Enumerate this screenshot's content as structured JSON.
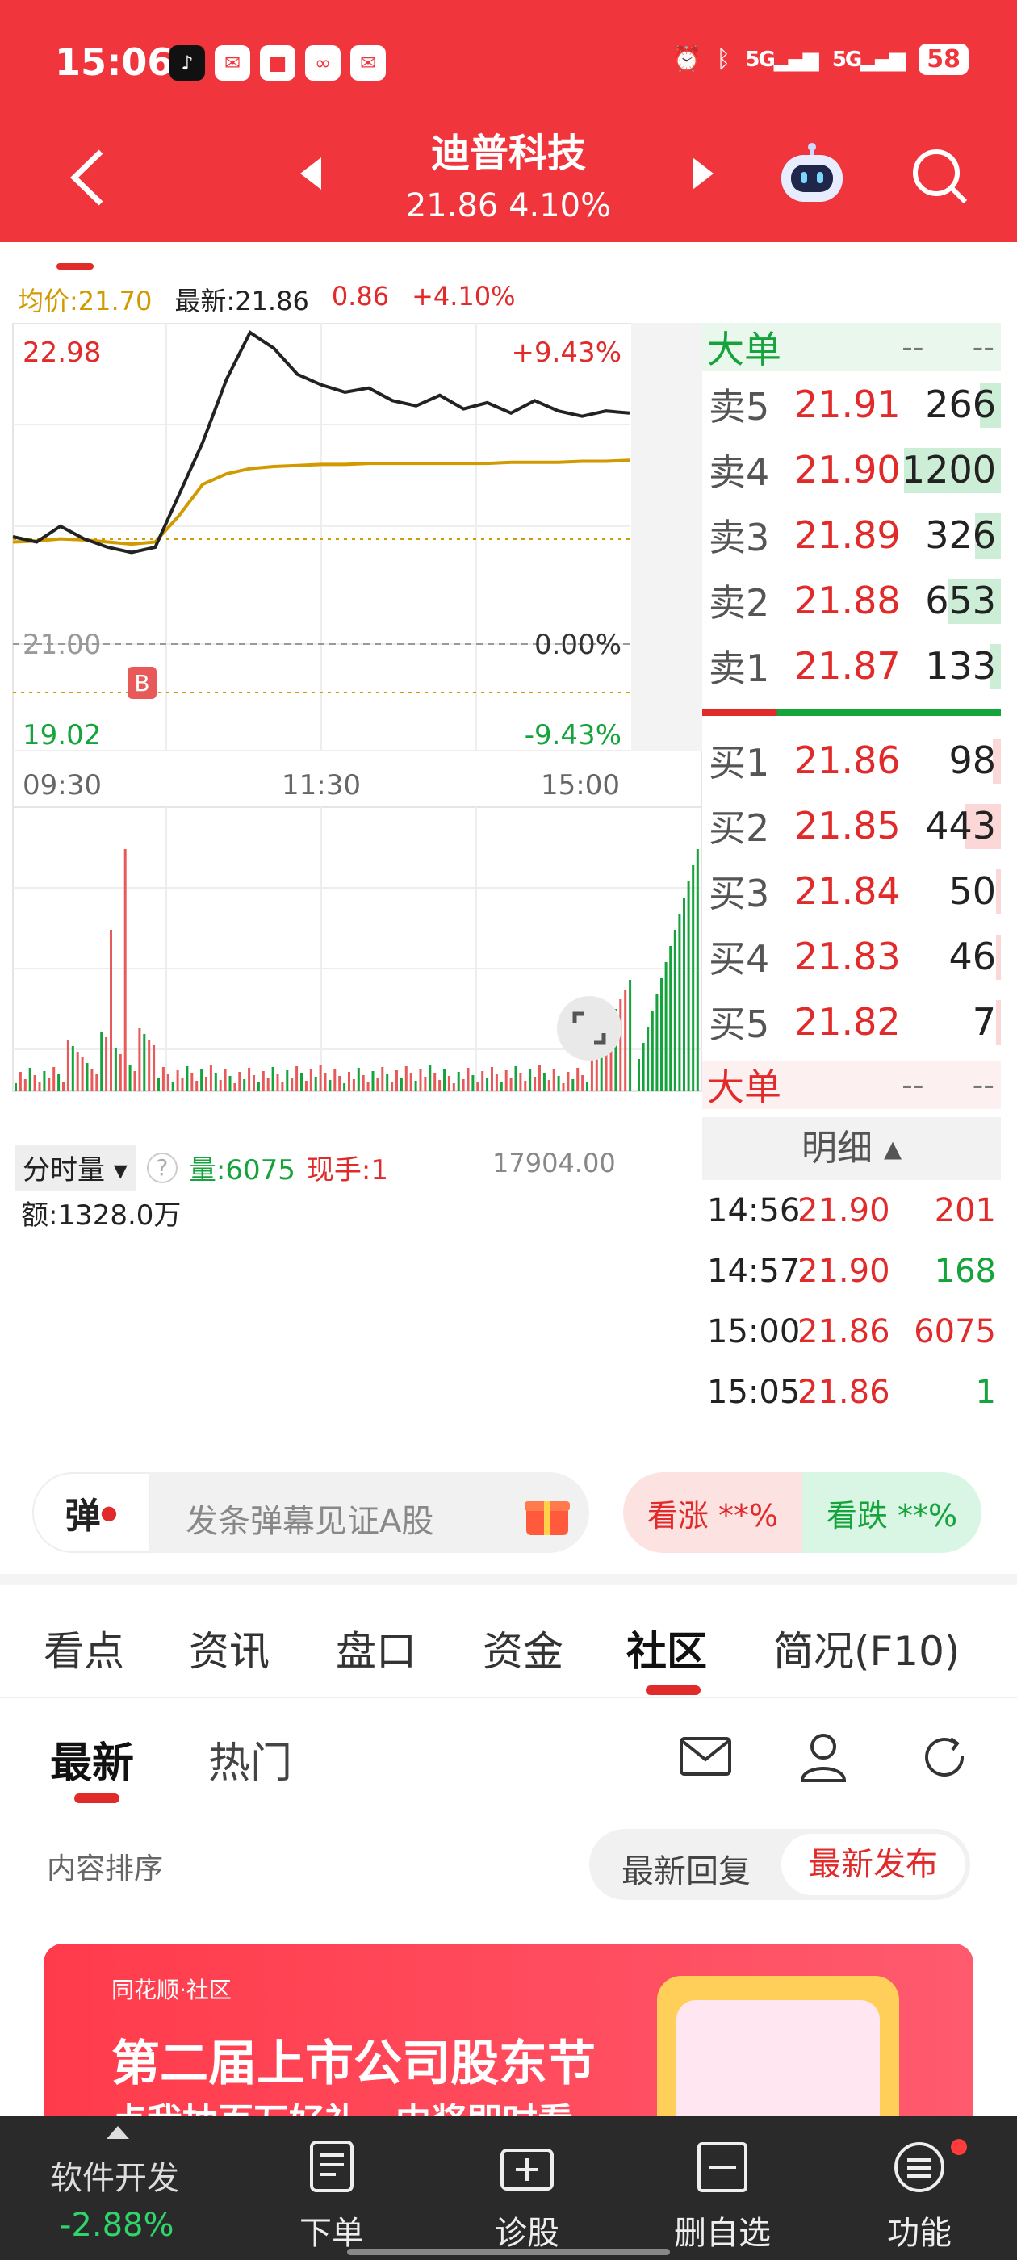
{
  "status": {
    "time": "15:06",
    "battery": "58",
    "signal1": "5G",
    "signal2": "5G"
  },
  "nav": {
    "title": "迪普科技",
    "subtitle": "21.86 4.10%"
  },
  "quote": {
    "avg": "均价:21.70",
    "latest": "最新:21.86",
    "change": "0.86",
    "pct": "+4.10%"
  },
  "chart": {
    "y_high": "22.98",
    "y_mid": "21.00",
    "y_low": "19.02",
    "pct_high": "+9.43%",
    "pct_mid": "0.00%",
    "pct_low": "-9.43%",
    "times": [
      "09:30",
      "11:30",
      "15:00"
    ],
    "marker": "B"
  },
  "chart_data": {
    "type": "line",
    "title": "",
    "ylim": [
      19.02,
      22.98
    ],
    "series": [
      {
        "values": [
          21.0,
          20.95,
          21.1,
          20.98,
          20.9,
          20.85,
          20.9,
          21.4,
          21.9,
          22.5,
          22.95,
          22.8,
          22.55,
          22.45,
          22.38,
          22.42,
          22.3,
          22.25,
          22.35,
          22.22,
          22.28,
          22.18,
          22.3,
          22.2,
          22.15,
          22.2,
          22.18
        ]
      },
      {
        "values": [
          20.95,
          20.96,
          20.98,
          20.97,
          20.95,
          20.93,
          20.95,
          21.2,
          21.5,
          21.6,
          21.65,
          21.67,
          21.68,
          21.69,
          21.69,
          21.7,
          21.7,
          21.7,
          21.7,
          21.7,
          21.7,
          21.71,
          21.71,
          21.71,
          21.72,
          21.72,
          21.73
        ]
      }
    ]
  },
  "book": {
    "big_label": "大单",
    "big_dash1": "--",
    "big_dash2": "--",
    "sells": [
      {
        "label": "卖5",
        "price": "21.91",
        "vol": "266",
        "ratio": 0.22
      },
      {
        "label": "卖4",
        "price": "21.90",
        "vol": "1200",
        "ratio": 1.0
      },
      {
        "label": "卖3",
        "price": "21.89",
        "vol": "326",
        "ratio": 0.27
      },
      {
        "label": "卖2",
        "price": "21.88",
        "vol": "653",
        "ratio": 0.54
      },
      {
        "label": "卖1",
        "price": "21.87",
        "vol": "133",
        "ratio": 0.11
      }
    ],
    "buys": [
      {
        "label": "买1",
        "price": "21.86",
        "vol": "98",
        "ratio": 0.08
      },
      {
        "label": "买2",
        "price": "21.85",
        "vol": "443",
        "ratio": 0.37
      },
      {
        "label": "买3",
        "price": "21.84",
        "vol": "50",
        "ratio": 0.04
      },
      {
        "label": "买4",
        "price": "21.83",
        "vol": "46",
        "ratio": 0.04
      },
      {
        "label": "买5",
        "price": "21.82",
        "vol": "7",
        "ratio": 0.01
      }
    ],
    "big2_label": "大单",
    "big2_dash1": "--",
    "big2_dash2": "--",
    "detail_header": "明细",
    "details": [
      {
        "time": "14:56",
        "price": "21.90",
        "vol": "201",
        "color": "#e12a2a"
      },
      {
        "time": "14:57",
        "price": "21.90",
        "vol": "168",
        "color": "#15a33b"
      },
      {
        "time": "15:00",
        "price": "21.86",
        "vol": "6075",
        "color": "#e12a2a"
      },
      {
        "time": "15:05",
        "price": "21.86",
        "vol": "1",
        "color": "#15a33b"
      }
    ]
  },
  "volume": {
    "selector": "分时量",
    "vol": "量:6075",
    "hand": "现手:1",
    "amount": "额:1328.0万",
    "max": "17904.00"
  },
  "danmaku": {
    "icon_label": "弹",
    "placeholder": "发条弹幕见证A股",
    "up": "看涨 **%",
    "down": "看跌 **%"
  },
  "tabs": [
    "看点",
    "资讯",
    "盘口",
    "资金",
    "社区",
    "简况(F10)"
  ],
  "subtabs": [
    "最新",
    "热门"
  ],
  "sort": {
    "label": "内容排序",
    "opt1": "最新回复",
    "opt2": "最新发布"
  },
  "banner": {
    "brand": "同花顺·社区",
    "title": "第二届上市公司股东节",
    "sub": "点我抽百万好礼，中奖即时看"
  },
  "bottom": {
    "stock": "软件开发",
    "change": "-2.88%",
    "items": [
      "下单",
      "诊股",
      "删自选",
      "功能"
    ]
  },
  "colors": {
    "red": "#f0353c",
    "green": "#15a33b",
    "avg_line": "#d19a00"
  }
}
